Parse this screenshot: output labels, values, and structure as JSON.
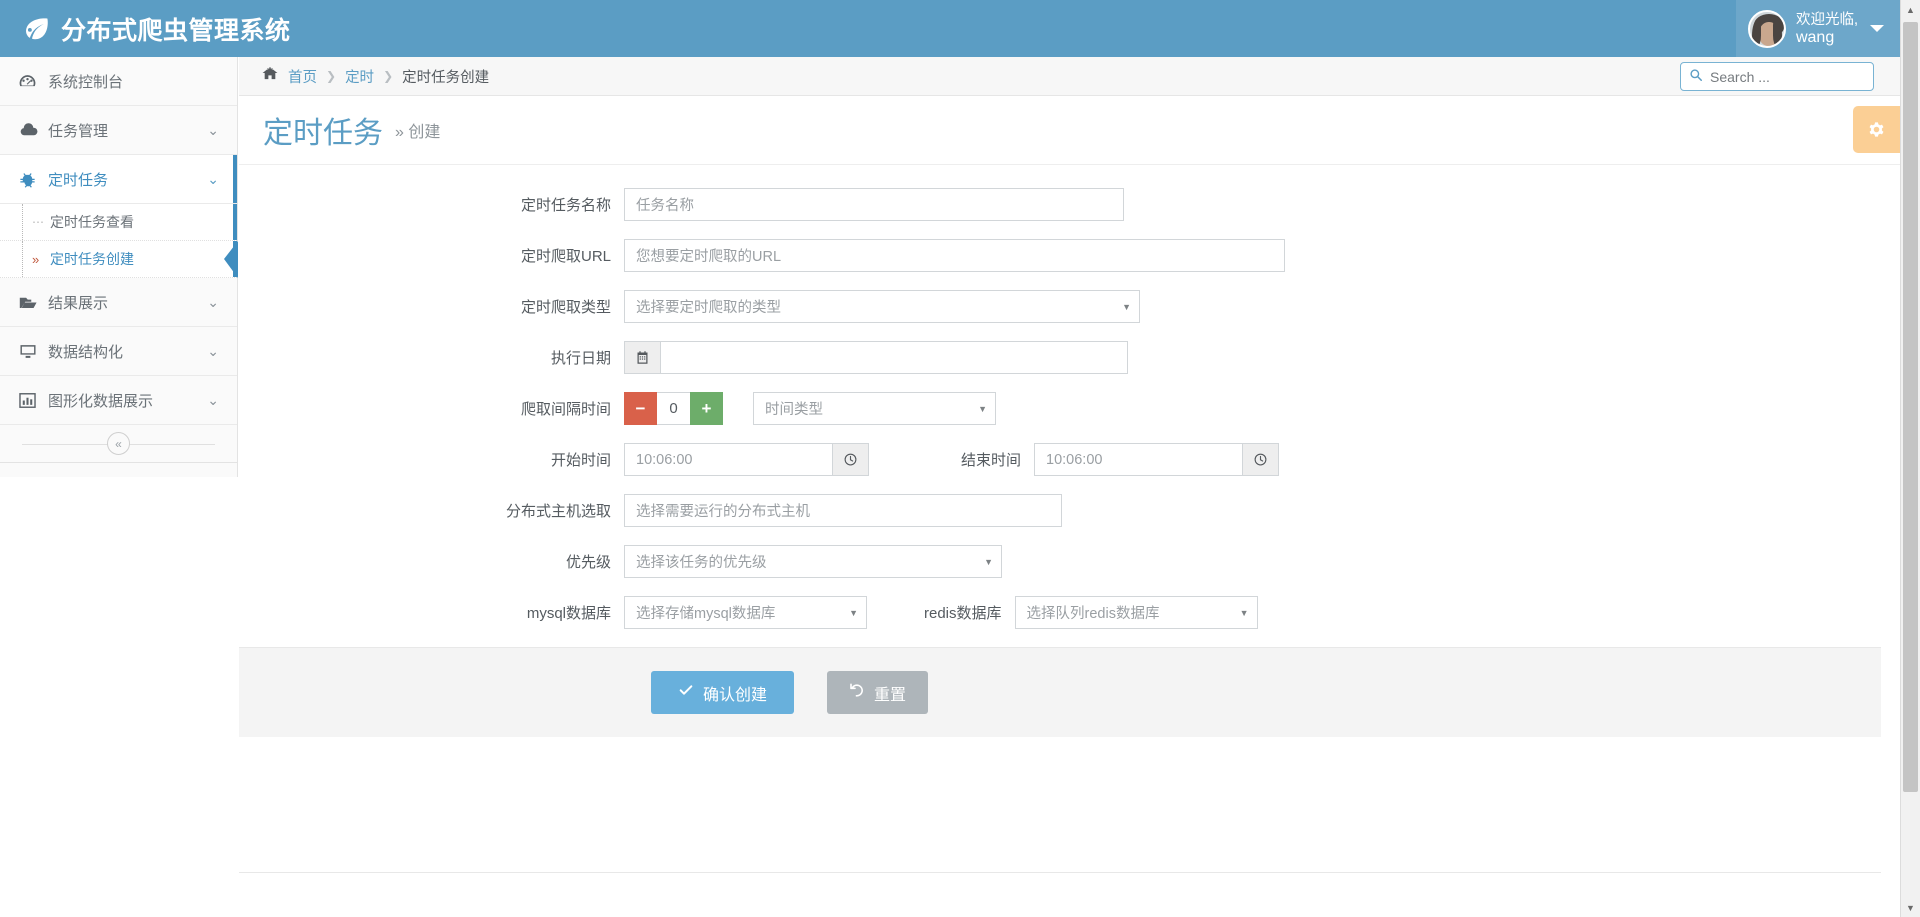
{
  "app": {
    "brand": "分布式爬虫管理系统",
    "brand_icon": "leaf-icon"
  },
  "user": {
    "greeting": "欢迎光临,",
    "name": "wang",
    "caret_icon": "chevron-down-icon",
    "avatar_icon": "user-avatar"
  },
  "sidebar": {
    "items": [
      {
        "label": "系统控制台",
        "icon": "dashboard-icon",
        "chevron": "",
        "active": false
      },
      {
        "label": "任务管理",
        "icon": "cloud-icon",
        "chevron": "⌄",
        "active": false
      },
      {
        "label": "定时任务",
        "icon": "bug-icon",
        "chevron": "⌄",
        "active": true
      },
      {
        "label": "结果展示",
        "icon": "folder-open-icon",
        "chevron": "⌄",
        "active": false
      },
      {
        "label": "数据结构化",
        "icon": "desktop-icon",
        "chevron": "⌄",
        "active": false
      },
      {
        "label": "图形化数据展示",
        "icon": "bar-chart-icon",
        "chevron": "⌄",
        "active": false
      }
    ],
    "subitems": [
      {
        "label": "定时任务查看",
        "marker": "⋯",
        "selected": false
      },
      {
        "label": "定时任务创建",
        "marker": "»",
        "selected": true
      }
    ],
    "collapse_label": "«",
    "collapse_icon": "collapse-chevrons-icon"
  },
  "breadcrumb": {
    "home_icon": "home-icon",
    "items": [
      "首页",
      "定时",
      "定时任务创建"
    ],
    "separator": "❯"
  },
  "search": {
    "placeholder": "Search ...",
    "value": "",
    "icon": "search-icon"
  },
  "page": {
    "title": "定时任务",
    "subtitle": "» 创建",
    "gear_icon": "gear-icon"
  },
  "form": {
    "task_name": {
      "label": "定时任务名称",
      "placeholder": "任务名称",
      "value": ""
    },
    "crawl_url": {
      "label": "定时爬取URL",
      "placeholder": "您想要定时爬取的URL",
      "value": ""
    },
    "crawl_type": {
      "label": "定时爬取类型",
      "placeholder": "选择要定时爬取的类型",
      "value": "",
      "arrow": "▼"
    },
    "exec_date": {
      "label": "执行日期",
      "placeholder": "",
      "value": "",
      "icon": "calendar-icon"
    },
    "interval": {
      "label": "爬取间隔时间",
      "minus": "−",
      "plus": "+",
      "value": "0",
      "unit_placeholder": "时间类型",
      "unit_value": "",
      "arrow": "▼"
    },
    "start_time": {
      "label": "开始时间",
      "value": "10:06:00",
      "icon": "clock-icon"
    },
    "end_time": {
      "label": "结束时间",
      "value": "10:06:00",
      "icon": "clock-icon"
    },
    "host_select": {
      "label": "分布式主机选取",
      "placeholder": "选择需要运行的分布式主机",
      "value": ""
    },
    "priority": {
      "label": "优先级",
      "placeholder": "选择该任务的优先级",
      "value": "",
      "arrow": "▼"
    },
    "mysql_db": {
      "label": "mysql数据库",
      "placeholder": "选择存储mysql数据库",
      "value": "",
      "arrow": "▼"
    },
    "redis_db": {
      "label": "redis数据库",
      "placeholder": "选择队列redis数据库",
      "value": "",
      "arrow": "▼"
    }
  },
  "actions": {
    "submit": {
      "label": "确认创建",
      "icon": "check-icon"
    },
    "reset": {
      "label": "重置",
      "icon": "undo-icon"
    }
  },
  "scrollbar": {
    "up_icon": "▲",
    "down_icon": "▼"
  },
  "colors": {
    "brand_blue": "#5b9dc4",
    "accent_link": "#3f8dbf",
    "primary_button": "#68b0dc",
    "default_button": "#aeb5ba",
    "minus_red": "#d9614a",
    "plus_green": "#6dad6a",
    "gear_orange": "#fbcf95"
  }
}
